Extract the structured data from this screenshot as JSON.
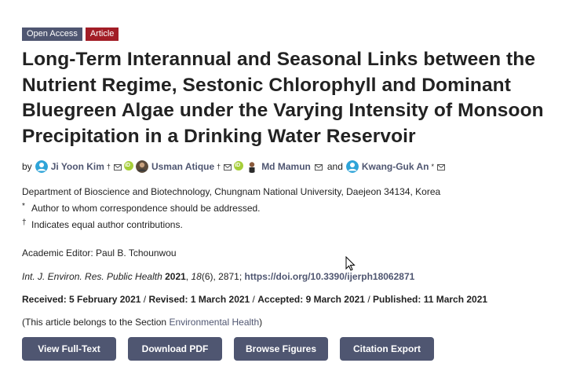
{
  "badges": {
    "open_access": "Open Access",
    "article": "Article"
  },
  "title": "Long-Term Interannual and Seasonal Links between the Nutrient Regime, Sestonic Chlorophyll and Dominant Bluegreen Algae under the Varying Intensity of Monsoon Precipitation in a Drinking Water Reservoir",
  "authors": {
    "by": "by",
    "list": [
      {
        "name": "Ji Yoon Kim",
        "mark": "†"
      },
      {
        "name": "Usman Atique",
        "mark": "†"
      },
      {
        "name": "Md Mamun",
        "mark": ""
      },
      {
        "name": "Kwang-Guk An",
        "mark": "*"
      }
    ],
    "and": "and"
  },
  "affiliation": {
    "department": "Department of Bioscience and Biotechnology, Chungnam National University, Daejeon 34134, Korea",
    "corr_mark": "*",
    "corr_text": "Author to whom correspondence should be addressed.",
    "equal_mark": "†",
    "equal_text": "Indicates equal author contributions."
  },
  "editor": "Academic Editor: Paul B. Tchounwou",
  "citation": {
    "journal": "Int. J. Environ. Res. Public Health",
    "year": "2021",
    "volume": "18",
    "issue_pages": "(6), 2871;",
    "doi": "https://doi.org/10.3390/ijerph18062871"
  },
  "dates": {
    "received_label": "Received:",
    "received": "5 February 2021",
    "revised_label": "Revised:",
    "revised": "1 March 2021",
    "accepted_label": "Accepted:",
    "accepted": "9 March 2021",
    "published_label": "Published:",
    "published": "11 March 2021"
  },
  "section": {
    "prefix": "(This article belongs to the Section ",
    "link": "Environmental Health",
    "suffix": ")"
  },
  "buttons": {
    "view_full_text": "View Full-Text",
    "download_pdf": "Download PDF",
    "browse_figures": "Browse Figures",
    "citation_export": "Citation Export"
  },
  "colors": {
    "accent": "#4f5671",
    "article_badge": "#a21d26",
    "orcid": "#a6ce39"
  }
}
